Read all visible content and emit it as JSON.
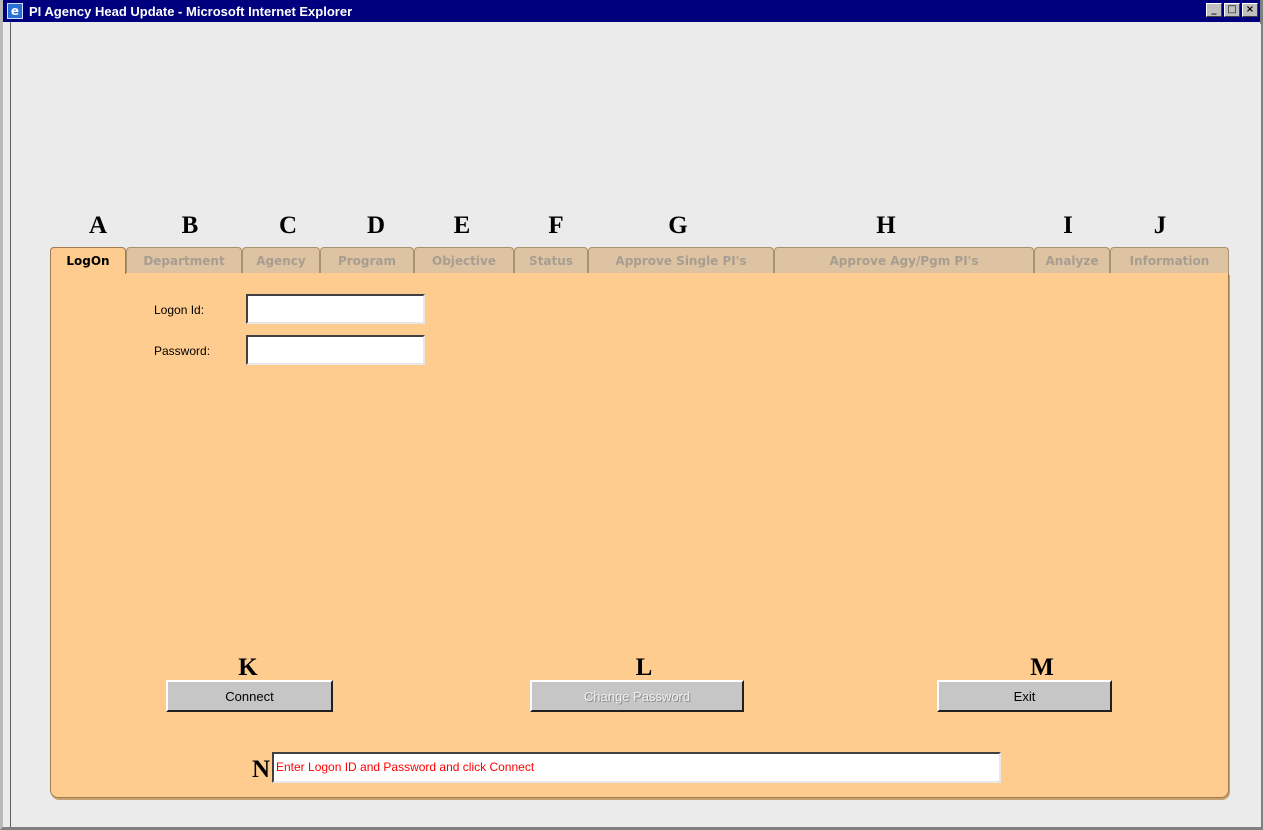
{
  "window": {
    "title": "PI Agency Head Update - Microsoft Internet Explorer",
    "controls": {
      "minimize": "_",
      "maximize": "□",
      "close": "×"
    }
  },
  "markers": {
    "tabs": [
      "A",
      "B",
      "C",
      "D",
      "E",
      "F",
      "G",
      "H",
      "I",
      "J"
    ],
    "buttons": [
      "K",
      "L",
      "M"
    ],
    "status": "N"
  },
  "tabs": [
    {
      "label": "LogOn",
      "active": true
    },
    {
      "label": "Department",
      "active": false
    },
    {
      "label": "Agency",
      "active": false
    },
    {
      "label": "Program",
      "active": false
    },
    {
      "label": "Objective",
      "active": false
    },
    {
      "label": "Status",
      "active": false
    },
    {
      "label": "Approve Single PI's",
      "active": false
    },
    {
      "label": "Approve Agy/Pgm PI's",
      "active": false
    },
    {
      "label": "Analyze",
      "active": false
    },
    {
      "label": "Information",
      "active": false
    }
  ],
  "logon": {
    "logon_id_label": "Logon Id:",
    "logon_id_value": "",
    "password_label": "Password:",
    "password_value": ""
  },
  "buttons": {
    "connect": "Connect",
    "change_password": "Change Password",
    "exit": "Exit"
  },
  "status_message": "Enter Logon ID and Password and click Connect"
}
